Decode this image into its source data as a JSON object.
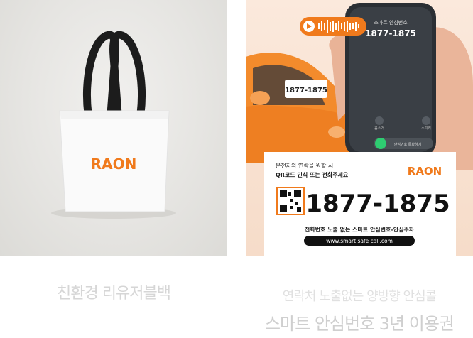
{
  "left_card": {
    "logo_text": "RAON",
    "caption": "친환경 리유저블백"
  },
  "right_card": {
    "audio_bubble": "",
    "phone": {
      "header_small": "스마트 안심번호",
      "number": "1877-1875",
      "btn_left": "음소거",
      "btn_right": "스피커",
      "call_label": "안심번호 통화하기"
    },
    "car_sign_number": "1877-1875",
    "sign": {
      "line1": "운전자와 연락을 원할 시",
      "line2": "QR코드 인식 또는 전화주세요",
      "brand": "RAON",
      "number": "1877-1875",
      "tagline": "전화번호 노출 없는 스마트 안심번호-안심주차",
      "url": "www.smart safe call.com"
    },
    "caption_line1": "연락처 노출없는 양방향 안심콜",
    "caption_line2": "스마트 안심번호 3년 이용권"
  },
  "colors": {
    "brand_orange": "#f07a1c",
    "car_orange": "#f38b2c",
    "phone_dark": "#2b2f34"
  }
}
